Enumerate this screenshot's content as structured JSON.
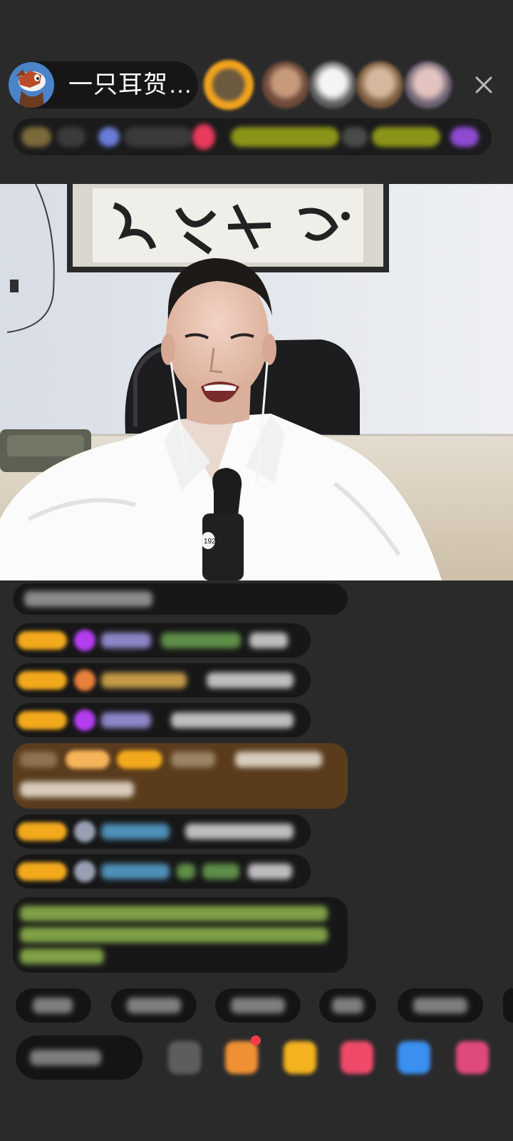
{
  "header": {
    "host_name": "一只耳贺…",
    "close_icon": "close-icon"
  }
}
